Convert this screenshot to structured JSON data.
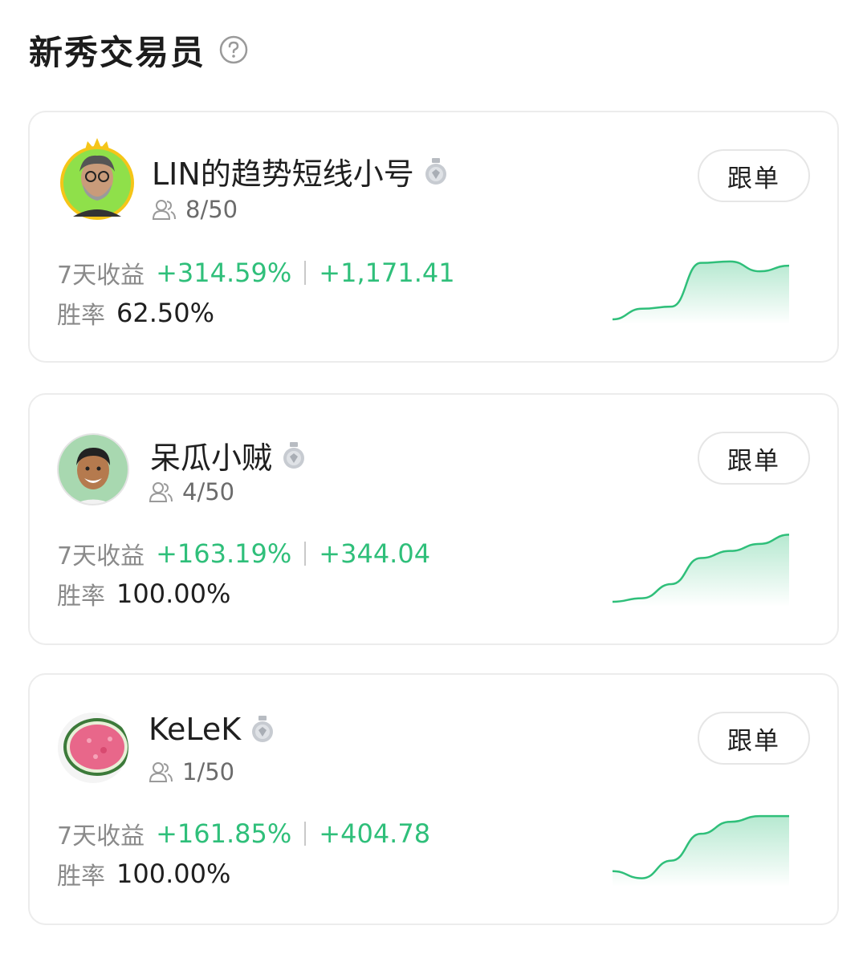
{
  "header": {
    "title": "新秀交易员",
    "help_icon": "question-circle-icon"
  },
  "labels": {
    "seven_day": "7天收益",
    "win_rate": "胜率",
    "follow": "跟单"
  },
  "colors": {
    "accent_green": "#2fbf7a",
    "text_dark": "#1f1f1f",
    "text_muted": "#8a8a8a",
    "border": "#ececec"
  },
  "traders": [
    {
      "name": "LIN的趋势短线小号",
      "followers": "8/50",
      "return_pct": "+314.59%",
      "return_amount": "+1,171.41",
      "win_rate": "62.50%",
      "avatar": "man-with-glasses-crown-avatar",
      "sparkline": [
        0,
        0.15,
        0.18,
        0.8,
        0.82,
        0.68,
        0.76
      ]
    },
    {
      "name": "呆瓜小贼",
      "followers": "4/50",
      "return_pct": "+163.19%",
      "return_amount": "+344.04",
      "win_rate": "100.00%",
      "avatar": "smiling-man-avatar",
      "sparkline": [
        0,
        0.05,
        0.25,
        0.62,
        0.72,
        0.82,
        0.95
      ]
    },
    {
      "name": "KeLeK",
      "followers": "1/50",
      "return_pct": "+161.85%",
      "return_amount": "+404.78",
      "win_rate": "100.00%",
      "avatar": "watermelon-avatar",
      "sparkline": [
        0.15,
        0.05,
        0.3,
        0.68,
        0.85,
        0.93,
        0.93
      ]
    }
  ]
}
